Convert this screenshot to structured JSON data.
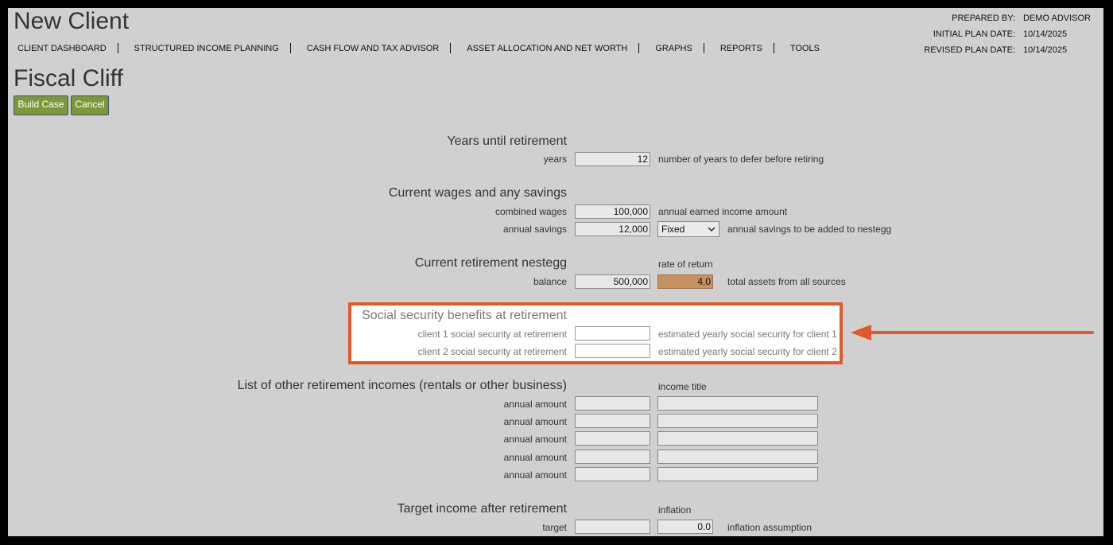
{
  "header": {
    "app_title": "New Client",
    "page_title": "Fiscal Cliff"
  },
  "nav": {
    "items": [
      {
        "label": "CLIENT DASHBOARD"
      },
      {
        "label": "STRUCTURED INCOME PLANNING"
      },
      {
        "label": "CASH FLOW AND TAX ADVISOR"
      },
      {
        "label": "ASSET ALLOCATION AND NET WORTH"
      },
      {
        "label": "GRAPHS"
      },
      {
        "label": "REPORTS"
      },
      {
        "label": "TOOLS"
      }
    ]
  },
  "meta": {
    "prepared_by_label": "PREPARED BY:",
    "prepared_by": "DEMO ADVISOR",
    "initial_label": "INITIAL PLAN DATE:",
    "initial": "10/14/2025",
    "revised_label": "REVISED PLAN DATE:",
    "revised": "10/14/2025"
  },
  "buttons": {
    "build": "Build Case",
    "cancel": "Cancel"
  },
  "years": {
    "heading": "Years until retirement",
    "label": "years",
    "value": "12",
    "hint": "number of years to defer before retiring"
  },
  "wages": {
    "heading": "Current wages and any savings",
    "combined_label": "combined wages",
    "combined_value": "100,000",
    "combined_hint": "annual earned income amount",
    "savings_label": "annual savings",
    "savings_value": "12,000",
    "savings_mode": "Fixed",
    "savings_hint": "annual savings to be added to nestegg"
  },
  "nestegg": {
    "heading": "Current retirement nestegg",
    "rate_label": "rate of return",
    "balance_label": "balance",
    "balance_value": "500,000",
    "rate_value": "4.0",
    "hint": "total assets from all sources"
  },
  "social_security": {
    "heading": "Social security benefits at retirement",
    "client1_label": "client 1 social security at retirement",
    "client1_hint": "estimated yearly social security for client 1",
    "client2_label": "client 2 social security at retirement",
    "client2_hint": "estimated yearly social security for client 2"
  },
  "other_incomes": {
    "heading": "List of other retirement incomes (rentals or other business)",
    "title_label": "income title",
    "rows": [
      {
        "label": "annual amount"
      },
      {
        "label": "annual amount"
      },
      {
        "label": "annual amount"
      },
      {
        "label": "annual amount"
      },
      {
        "label": "annual amount"
      }
    ]
  },
  "target": {
    "heading": "Target income after retirement",
    "inflation_label": "inflation",
    "target_label": "target",
    "inflation_value": "0.0",
    "hint": "inflation assumption"
  },
  "colors": {
    "highlight": "#e0592a",
    "button": "#7a9a3a",
    "rate_field": "#c8905f"
  }
}
